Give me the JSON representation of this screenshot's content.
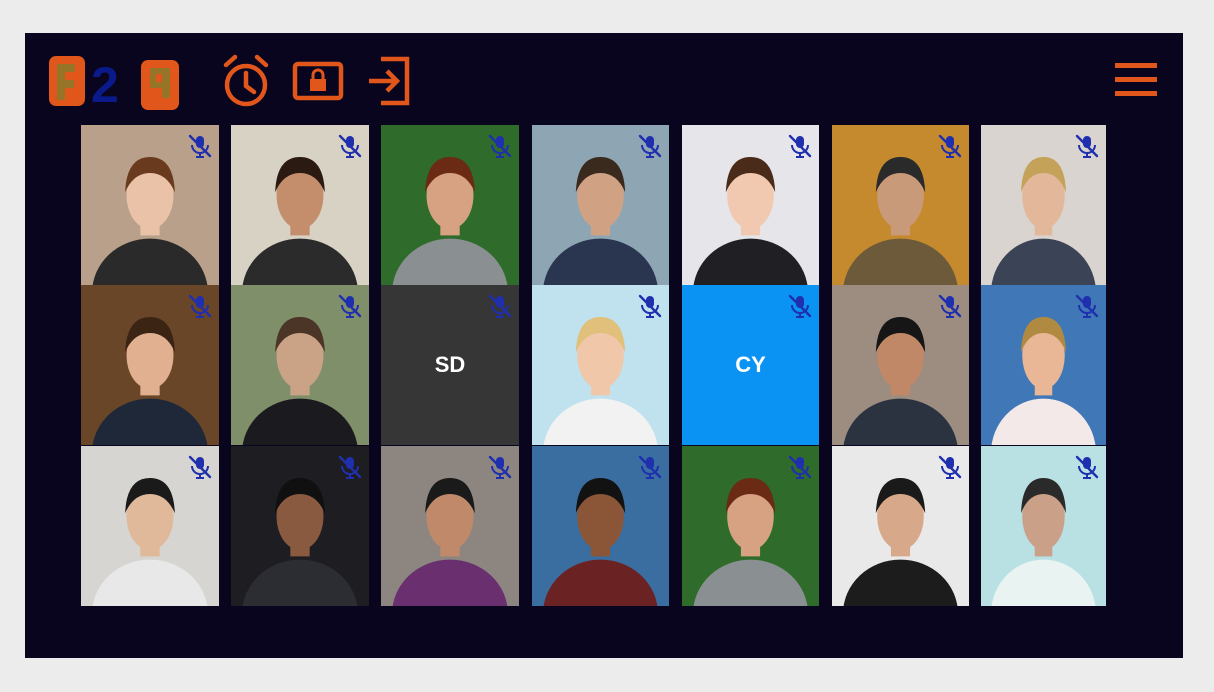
{
  "app": {
    "background": "#09051f",
    "accent": "#e0561b",
    "logo_text": "F2F"
  },
  "toolbar": [
    {
      "name": "alarm-clock-icon"
    },
    {
      "name": "lock-screen-icon"
    },
    {
      "name": "exit-icon"
    }
  ],
  "menu": {
    "icon": "hamburger-menu-icon"
  },
  "participants": [
    {
      "id": "p1",
      "initials": "",
      "muted": true
    },
    {
      "id": "p2",
      "initials": "",
      "muted": true
    },
    {
      "id": "p3",
      "initials": "",
      "muted": true
    },
    {
      "id": "p4",
      "initials": "",
      "muted": true
    },
    {
      "id": "p5",
      "initials": "",
      "muted": true
    },
    {
      "id": "p6",
      "initials": "",
      "muted": true
    },
    {
      "id": "p7",
      "initials": "",
      "muted": true
    },
    {
      "id": "p8",
      "initials": "",
      "muted": true
    },
    {
      "id": "p9",
      "initials": "",
      "muted": true
    },
    {
      "id": "p10",
      "initials": "SD",
      "muted": true,
      "tile_color": "#363636"
    },
    {
      "id": "p11",
      "initials": "",
      "muted": true
    },
    {
      "id": "p12",
      "initials": "CY",
      "muted": true,
      "tile_color": "#0a93f2"
    },
    {
      "id": "p13",
      "initials": "",
      "muted": true
    },
    {
      "id": "p14",
      "initials": "",
      "muted": true
    },
    {
      "id": "p15",
      "initials": "",
      "muted": true
    },
    {
      "id": "p16",
      "initials": "",
      "muted": true
    },
    {
      "id": "p17",
      "initials": "",
      "muted": true
    },
    {
      "id": "p18",
      "initials": "",
      "muted": true
    },
    {
      "id": "p19",
      "initials": "",
      "muted": true
    },
    {
      "id": "p20",
      "initials": "",
      "muted": true
    },
    {
      "id": "p21",
      "initials": "",
      "muted": true
    }
  ]
}
